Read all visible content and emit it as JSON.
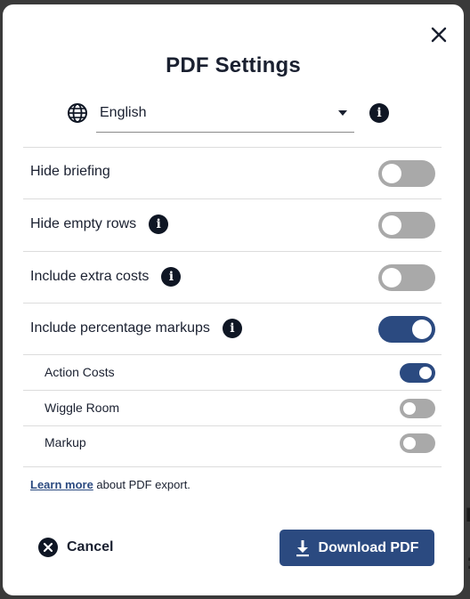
{
  "dialog": {
    "title": "PDF Settings",
    "language": {
      "selected": "English"
    },
    "settings": [
      {
        "label": "Hide briefing",
        "has_info": false,
        "enabled": false
      },
      {
        "label": "Hide empty rows",
        "has_info": true,
        "enabled": false
      },
      {
        "label": "Include extra costs",
        "has_info": true,
        "enabled": false
      },
      {
        "label": "Include percentage markups",
        "has_info": true,
        "enabled": true
      }
    ],
    "markup_options": [
      {
        "label": "Action Costs",
        "enabled": true
      },
      {
        "label": "Wiggle Room",
        "enabled": false
      },
      {
        "label": "Markup",
        "enabled": false
      }
    ],
    "footer_note": {
      "link": "Learn more",
      "text": " about PDF export."
    },
    "buttons": {
      "cancel": "Cancel",
      "download": "Download PDF"
    }
  },
  "colors": {
    "primary": "#2b4a80",
    "toggle_off": "#a9a9a9",
    "text": "#1a2030"
  },
  "icons": [
    "close-icon",
    "globe-icon",
    "info-icon",
    "chevron-down-icon",
    "cancel-x-icon",
    "download-icon"
  ]
}
